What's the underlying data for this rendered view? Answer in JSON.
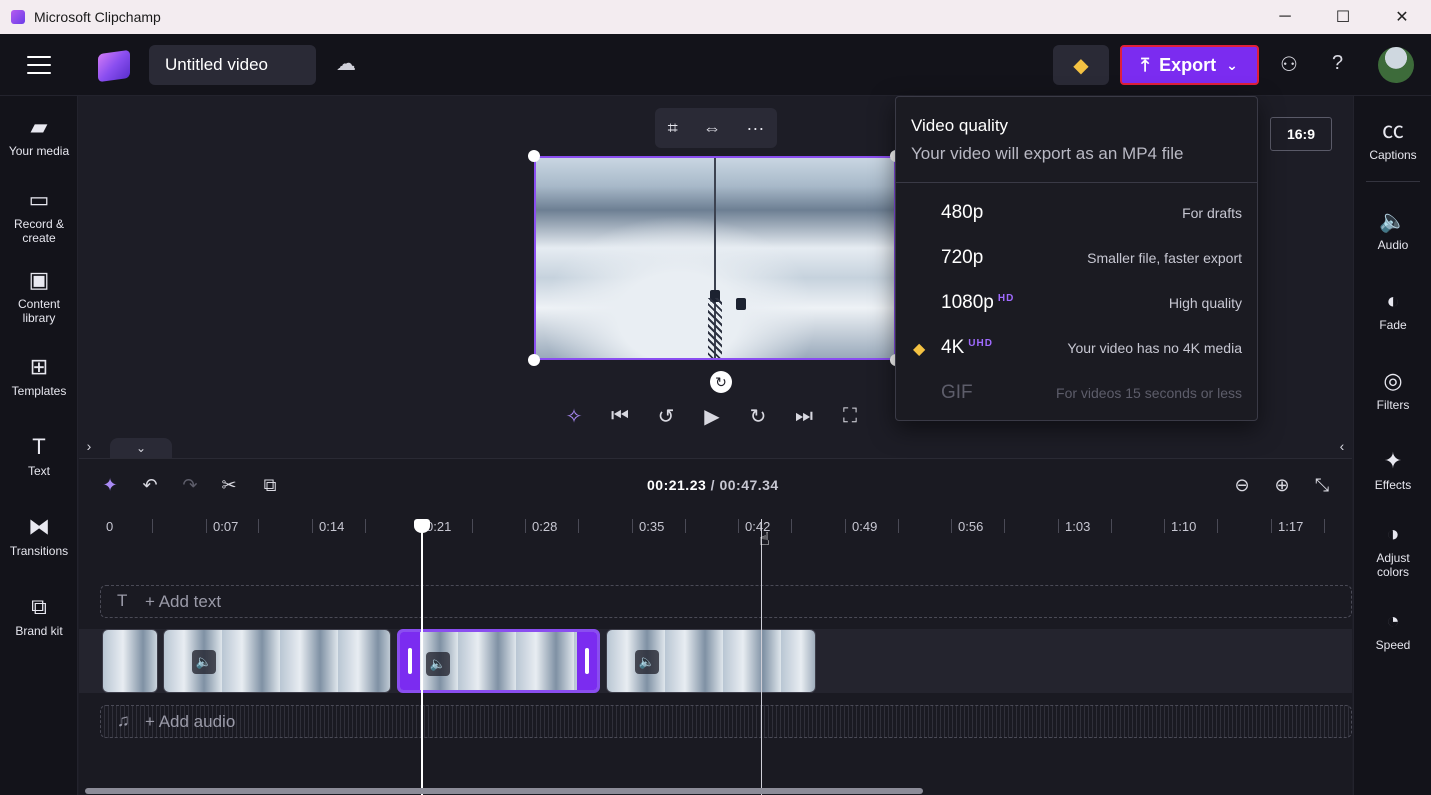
{
  "window": {
    "title": "Microsoft Clipchamp",
    "minimize": "─",
    "maximize": "☐",
    "close": "✕"
  },
  "header": {
    "project_title": "Untitled video",
    "export_label": "Export",
    "export_icon": "⤒",
    "chevron": "⌄",
    "premium_icon": "◆",
    "cloud_icon": "☁",
    "share_icon": "⚇",
    "help_icon": "?"
  },
  "left_rail": [
    {
      "label": "Your media",
      "icon": "▰"
    },
    {
      "label": "Record &\ncreate",
      "icon": "▭"
    },
    {
      "label": "Content\nlibrary",
      "icon": "▣"
    },
    {
      "label": "Templates",
      "icon": "⊞"
    },
    {
      "label": "Text",
      "icon": "T"
    },
    {
      "label": "Transitions",
      "icon": "⧓"
    },
    {
      "label": "Brand kit",
      "icon": "⧉"
    }
  ],
  "right_rail": [
    {
      "label": "Captions",
      "icon": "㏄"
    },
    {
      "label": "Audio",
      "icon": "🔈"
    },
    {
      "label": "Fade",
      "icon": "◐"
    },
    {
      "label": "Filters",
      "icon": "◎"
    },
    {
      "label": "Effects",
      "icon": "✦"
    },
    {
      "label": "Adjust\ncolors",
      "icon": "◑"
    },
    {
      "label": "Speed",
      "icon": "◔"
    }
  ],
  "preview": {
    "aspect_ratio": "16:9",
    "toolbar": {
      "crop": "⌗",
      "fit": "⇔",
      "more": "···"
    },
    "rotate": "↻",
    "playback": {
      "magic": "✧",
      "skip_start": "⏮",
      "back5": "↺",
      "play": "▶",
      "fwd5": "↻",
      "skip_end": "⏭",
      "fullscreen": "⛶"
    }
  },
  "export_menu": {
    "title": "Video quality",
    "subtitle": "Your video will export as an MP4 file",
    "options": [
      {
        "label": "480p",
        "badge": "",
        "desc": "For drafts",
        "enabled": true
      },
      {
        "label": "720p",
        "badge": "",
        "desc": "Smaller file, faster export",
        "enabled": true
      },
      {
        "label": "1080p",
        "badge": "HD",
        "desc": "High quality",
        "enabled": true
      },
      {
        "label": "4K",
        "badge": "UHD",
        "desc": "Your video has no 4K media",
        "enabled": true,
        "premium": true
      },
      {
        "label": "GIF",
        "badge": "",
        "desc": "For videos 15 seconds or less",
        "enabled": false
      }
    ]
  },
  "timeline": {
    "current_time": "00:21.23",
    "separator": " / ",
    "total_time": "00:47.34",
    "ruler": [
      "0",
      "0:07",
      "0:14",
      "0:21",
      "0:28",
      "0:35",
      "0:42",
      "0:49",
      "0:56",
      "1:03",
      "1:10",
      "1:17"
    ],
    "add_text": "+ Add text",
    "add_audio": "+ Add audio",
    "tools": {
      "ai": "✦",
      "undo": "↶",
      "redo": "↷",
      "cut": "✂",
      "add_media": "⧉",
      "zoom_out": "⊖",
      "zoom_in": "⊕",
      "fit": "⤡"
    }
  }
}
